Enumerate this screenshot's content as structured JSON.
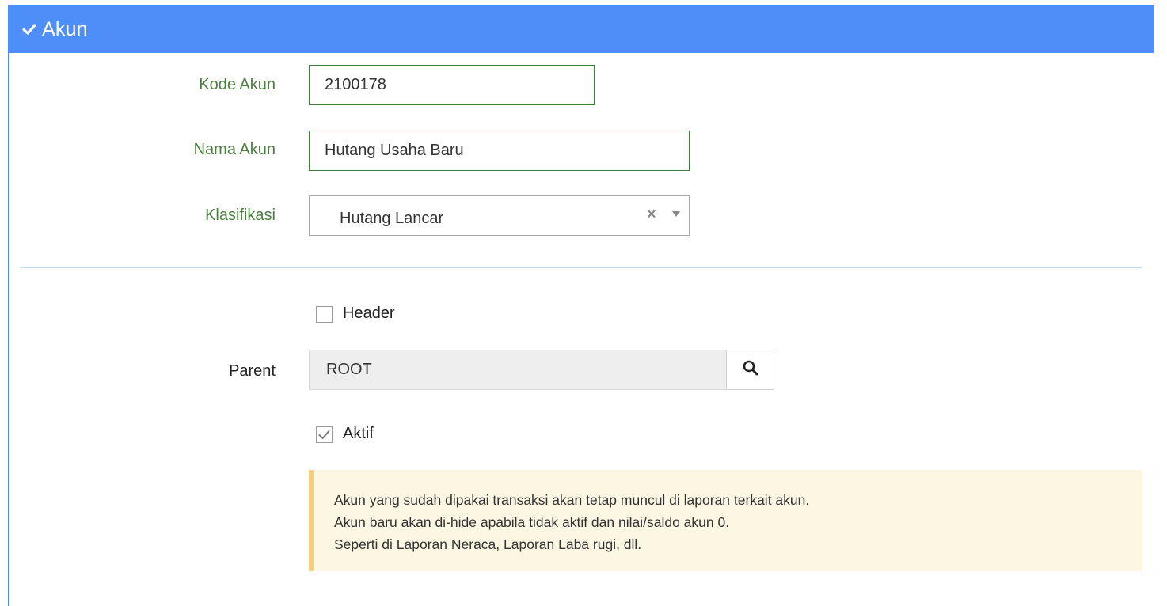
{
  "panel": {
    "title": "Akun",
    "header_color": "#4d8ef8"
  },
  "form": {
    "kode_akun_label": "Kode Akun",
    "kode_akun_value": "2100178",
    "nama_akun_label": "Nama Akun",
    "nama_akun_value": "Hutang Usaha Baru",
    "klasifikasi_label": "Klasifikasi",
    "klasifikasi_value": "Hutang Lancar",
    "clear_glyph": "×",
    "header_label": "Header",
    "header_checked": false,
    "parent_label": "Parent",
    "parent_value": "ROOT",
    "aktif_label": "Aktif",
    "aktif_checked": true
  },
  "notice": {
    "lines": [
      "Akun yang sudah dipakai transaksi akan tetap muncul di laporan terkait akun.",
      "Akun baru akan di-hide apabila tidak aktif dan nilai/saldo akun 0.",
      "Seperti di Laporan Neraca, Laporan Laba rugi, dll."
    ]
  },
  "icons": {
    "title_icon": "check-icon",
    "parent_search": "search-icon",
    "select_arrow": "caret-down-icon",
    "select_clear": "clear-icon"
  }
}
